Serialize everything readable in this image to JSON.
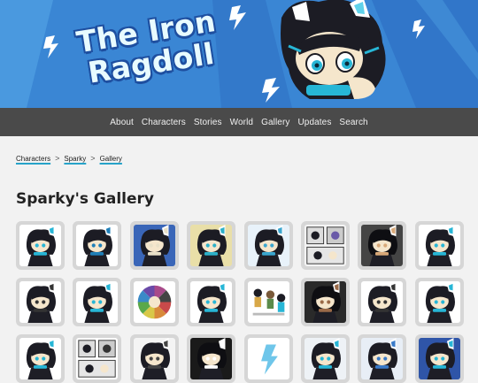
{
  "site": {
    "logo_line1": "The Iron",
    "logo_line2": "Ragdoll",
    "logo_image": "banner-character-art"
  },
  "nav": {
    "items": [
      "About",
      "Characters",
      "Stories",
      "World",
      "Gallery",
      "Updates",
      "Search"
    ]
  },
  "breadcrumb": {
    "items": [
      "Characters",
      "Sparky",
      "Gallery"
    ],
    "separator": ">"
  },
  "page": {
    "title": "Sparky's Gallery"
  },
  "gallery": {
    "thumbnails": [
      {
        "bg": "#ffffff",
        "accent": "#27b6d6",
        "icon": "character-art-thumbnail"
      },
      {
        "bg": "#ffffff",
        "accent": "#1f7fb8",
        "icon": "character-art-thumbnail"
      },
      {
        "bg": "#3a66b8",
        "accent": "#e8e0c8",
        "icon": "character-art-thumbnail"
      },
      {
        "bg": "#e9dfa8",
        "accent": "#2cb0c8",
        "icon": "character-art-thumbnail"
      },
      {
        "bg": "#e8f2fa",
        "accent": "#3aa6cf",
        "icon": "character-art-thumbnail"
      },
      {
        "bg": "#f4f4f4",
        "accent": "#6a5aa8",
        "icon": "comic-page-thumbnail"
      },
      {
        "bg": "#444444",
        "accent": "#d8a878",
        "icon": "character-art-thumbnail"
      },
      {
        "bg": "#ffffff",
        "accent": "#27b6d6",
        "icon": "character-art-thumbnail"
      },
      {
        "bg": "#ffffff",
        "accent": "#333333",
        "icon": "character-art-thumbnail"
      },
      {
        "bg": "#ffffff",
        "accent": "#27b6d6",
        "icon": "character-art-thumbnail"
      },
      {
        "bg": "#ffffff",
        "accent": "#c84a4a",
        "icon": "color-wheel-thumbnail"
      },
      {
        "bg": "#ffffff",
        "accent": "#27b6d6",
        "icon": "character-art-thumbnail"
      },
      {
        "bg": "#ffffff",
        "accent": "#d8a848",
        "icon": "character-sheet-thumbnail"
      },
      {
        "bg": "#2a2a2a",
        "accent": "#9a6a48",
        "icon": "character-art-thumbnail"
      },
      {
        "bg": "#ffffff",
        "accent": "#333333",
        "icon": "character-art-thumbnail"
      },
      {
        "bg": "#ffffff",
        "accent": "#27b6d6",
        "icon": "character-art-thumbnail"
      },
      {
        "bg": "#ffffff",
        "accent": "#27b6d6",
        "icon": "character-art-thumbnail"
      },
      {
        "bg": "#ffffff",
        "accent": "#333333",
        "icon": "comic-page-thumbnail"
      },
      {
        "bg": "#f4f4f4",
        "accent": "#444444",
        "icon": "character-art-thumbnail"
      },
      {
        "bg": "#1a1a1a",
        "accent": "#ffffff",
        "icon": "character-art-thumbnail"
      },
      {
        "bg": "#ffffff",
        "accent": "#6fc6ea",
        "icon": "lightning-thumbnail"
      },
      {
        "bg": "#eef2f6",
        "accent": "#27b6d6",
        "icon": "character-art-thumbnail"
      },
      {
        "bg": "#e8eef6",
        "accent": "#3a7ac8",
        "icon": "character-art-thumbnail"
      },
      {
        "bg": "#2f55a8",
        "accent": "#27b6d6",
        "icon": "character-art-thumbnail"
      }
    ]
  }
}
